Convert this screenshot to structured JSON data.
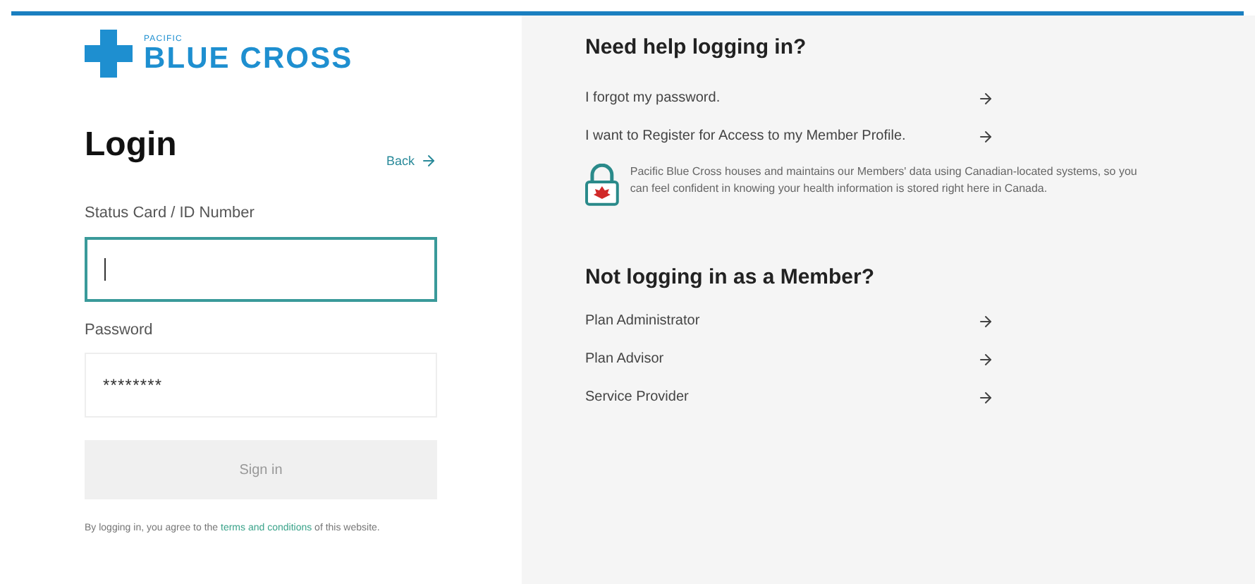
{
  "logo": {
    "small_text": "PACIFIC",
    "name": "BLUE CROSS"
  },
  "login": {
    "title": "Login",
    "back_link": "Back",
    "id_field": {
      "label": "Status Card / ID Number",
      "focused": true
    },
    "password_field": {
      "label": "Password",
      "value": "********",
      "focused": false
    },
    "submit_button": {
      "label": "Sign in",
      "disabled": true
    },
    "footnote": {
      "before": "By logging in, you agree to the ",
      "link": "terms and conditions",
      "after": " of this website."
    }
  },
  "help": {
    "title": "Need help logging in?",
    "links": [
      {
        "label": "I forgot my password."
      },
      {
        "label": "I want to Register for Access to my Member Profile."
      }
    ],
    "security_note": "Pacific Blue Cross houses and maintains our Members' data using Canadian-located systems, so you can feel confident in knowing your health information is stored right here in Canada."
  },
  "other": {
    "title": "Not logging in as a Member?",
    "links": [
      {
        "label": "Plan Administrator"
      },
      {
        "label": "Plan Advisor"
      },
      {
        "label": "Service Provider"
      }
    ]
  }
}
